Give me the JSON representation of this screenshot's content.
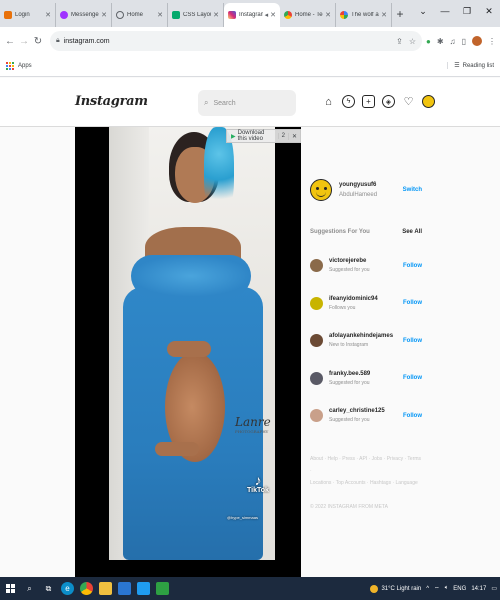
{
  "browser": {
    "tabs": [
      {
        "label": "Login",
        "color": "#e8710a"
      },
      {
        "label": "Messenger",
        "color": "#a033ff"
      },
      {
        "label": "Home",
        "color": "#5f6368"
      },
      {
        "label": "CSS Layout - The",
        "color": "#04aa6d"
      },
      {
        "label": "Instagram",
        "color": "#e1306c",
        "active": true
      },
      {
        "label": "Home - Techeno",
        "color": "#4285f4"
      },
      {
        "label": "The wolf and the",
        "color": "#4285f4"
      }
    ],
    "new_tab": "+",
    "url": "instagram.com",
    "bookmarks": {
      "apps_label": "Apps",
      "reading_list_label": "Reading list"
    }
  },
  "instagram": {
    "logo": "Instagram",
    "search_placeholder": "Search",
    "download_button": "Download this video",
    "download_count": "2",
    "signature": "Lanre",
    "signature_sub": "PHOTOGRAPHY",
    "tiktok_label": "TikTok",
    "tiktok_handle": "@hype_simmaas",
    "current_user": {
      "username": "youngyusuf6",
      "full_name": "AbdulHameed",
      "switch_label": "Switch"
    },
    "suggestions_title": "Suggestions For You",
    "see_all": "See All",
    "suggestions": [
      {
        "username": "victorejerebe",
        "subtitle": "Suggested for you",
        "follow": "Follow",
        "avatar_color": "#8a6a4a"
      },
      {
        "username": "ifeanyidominic94",
        "subtitle": "Follows you",
        "follow": "Follow",
        "avatar_color": "#c8b400"
      },
      {
        "username": "afolayankehindejames",
        "subtitle": "New to Instagram",
        "follow": "Follow",
        "avatar_color": "#6b4a34"
      },
      {
        "username": "franky.bee.589",
        "subtitle": "Suggested for you",
        "follow": "Follow",
        "avatar_color": "#5a5a66"
      },
      {
        "username": "carley_christine125",
        "subtitle": "Suggested for you",
        "follow": "Follow",
        "avatar_color": "#c9a08a"
      }
    ],
    "footer_links_1": "About · Help · Press · API · Jobs · Privacy · Terms ·",
    "footer_links_2": "Locations · Top Accounts · Hashtags · Language",
    "copyright": "© 2022 INSTAGRAM FROM META"
  },
  "taskbar": {
    "weather": "31°C  Light rain",
    "lang": "ENG",
    "time": "14:17"
  }
}
